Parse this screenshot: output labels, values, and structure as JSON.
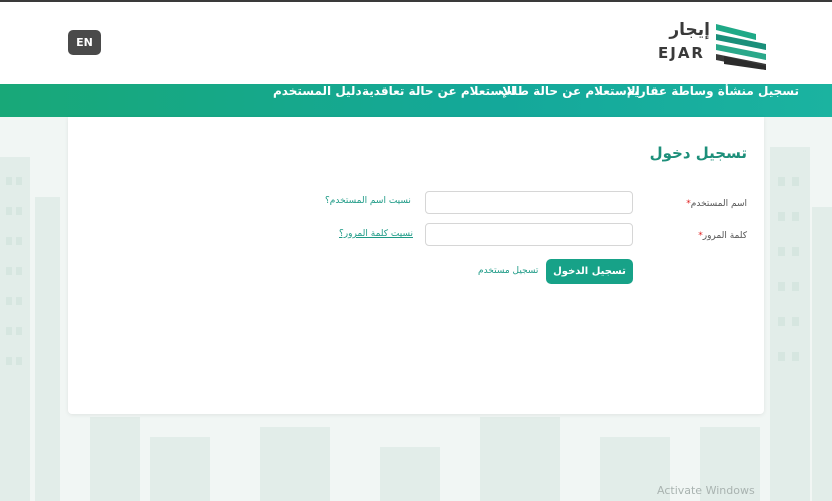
{
  "header": {
    "lang_button": "EN",
    "logo_ar": "إيجار",
    "logo_en": "EJAR"
  },
  "nav": {
    "items": [
      {
        "label": "تسجيل منشأة وساطة عقارية"
      },
      {
        "label": "الإستعلام عن حالة طلب"
      },
      {
        "label": "الإستعلام عن حالة تعاقدية"
      },
      {
        "label": "دليل المستخدم"
      }
    ]
  },
  "login": {
    "title": "تسجيل دخول",
    "username_label": "اسم المستخدم",
    "password_label": "كلمة المرور",
    "required_mark": "*",
    "username_value": "",
    "password_value": "",
    "forgot_username": "نسيت اسم المستخدم؟",
    "forgot_password": "نسيت كلمة المرور؟",
    "login_button": "تسجيل الدخول",
    "register_link": "تسجيل مستخدم"
  },
  "system": {
    "watermark": "Activate Windows"
  },
  "colors": {
    "accent": "#17a288",
    "title": "#1d8f7a",
    "nav_start": "#18a878",
    "nav_end": "#1bb3a0"
  }
}
